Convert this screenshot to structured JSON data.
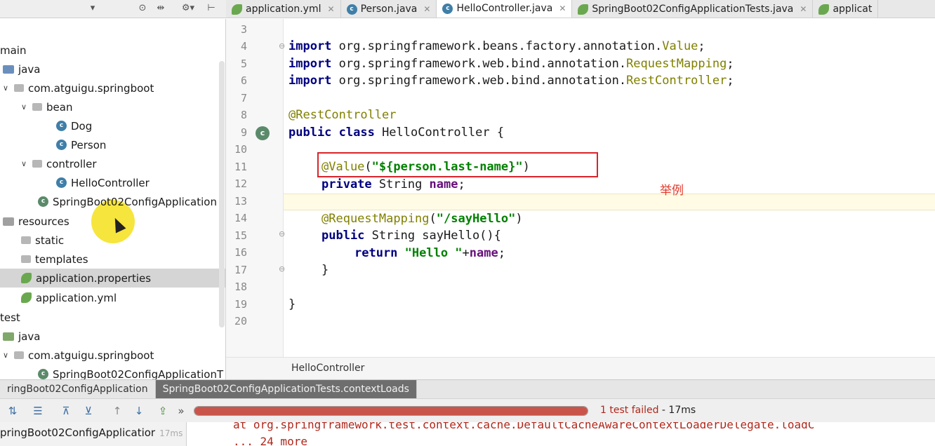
{
  "project_toolbar": {
    "dropdown_icon": "chevron-down-icon",
    "icons": [
      "target-icon",
      "split-icon",
      "gear-icon",
      "collapse-icon"
    ]
  },
  "editor_tabs": [
    {
      "label": "application.yml",
      "icon": "spring-leaf-icon",
      "active": false
    },
    {
      "label": "Person.java",
      "icon": "class-icon",
      "active": false
    },
    {
      "label": "HelloController.java",
      "icon": "class-icon",
      "active": true
    },
    {
      "label": "SpringBoot02ConfigApplicationTests.java",
      "icon": "spring-leaf-icon",
      "active": false
    },
    {
      "label": "applicat",
      "icon": "spring-leaf-icon",
      "active": false
    }
  ],
  "tree": {
    "main": "main",
    "java": "java",
    "pkg": "com.atguigu.springboot",
    "bean": "bean",
    "dog": "Dog",
    "person": "Person",
    "controller": "controller",
    "hello": "HelloController",
    "app": "SpringBoot02ConfigApplication",
    "resources": "resources",
    "static": "static",
    "templates": "templates",
    "app_props": "application.properties",
    "app_yml": "application.yml",
    "test": "test",
    "test_java": "java",
    "test_pkg": "com.atguigu.springboot",
    "test_class": "SpringBoot02ConfigApplicationT"
  },
  "code": {
    "lines": [
      "3",
      "4",
      "5",
      "6",
      "7",
      "8",
      "9",
      "10",
      "11",
      "12",
      "13",
      "14",
      "15",
      "16",
      "17",
      "18",
      "19",
      "20"
    ],
    "l4_kw": "import",
    "l4_pkg": " org.springframework.beans.factory.annotation.",
    "l4_cls": "Value",
    "l4_end": ";",
    "l5_kw": "import",
    "l5_pkg": " org.springframework.web.bind.annotation.",
    "l5_cls": "RequestMapping",
    "l5_end": ";",
    "l6_kw": "import",
    "l6_pkg": " org.springframework.web.bind.annotation.",
    "l6_cls": "RestController",
    "l6_end": ";",
    "l8": "@RestController",
    "l9_kw": "public class",
    "l9_rest": " HelloController {",
    "l11_ann": "@Value",
    "l11_p1": "(",
    "l11_str": "\"${person.last-name}\"",
    "l11_p2": ")",
    "l12_kw": "private",
    "l12_type": " String ",
    "l12_fld": "name",
    "l12_end": ";",
    "l14_ann": "@RequestMapping",
    "l14_p1": "(",
    "l14_str": "\"/sayHello\"",
    "l14_p2": ")",
    "l15_kw": "public",
    "l15_rest": " String sayHello(){",
    "l16_kw": "return",
    "l16_str": " \"Hello \"",
    "l16_plus": "+",
    "l16_fld": "name",
    "l16_end": ";",
    "l17": "}",
    "l19": "}"
  },
  "annotation_note": "举例",
  "breadcrumb": "HelloController",
  "run_tabs": [
    {
      "label": "ringBoot02ConfigApplication",
      "active": false
    },
    {
      "label": "SpringBoot02ConfigApplicationTests.contextLoads",
      "active": true
    }
  ],
  "run_toolbar_icons": [
    "sort-alpha-icon",
    "sort-duration-icon",
    "expand-all-icon",
    "collapse-all-icon",
    "up-arrow-icon",
    "down-arrow-icon",
    "export-icon",
    "more-icon"
  ],
  "test_result": {
    "progress": 1.0,
    "failed": "1 test failed",
    "time": " - 17ms"
  },
  "run_tree": {
    "item": "pringBoot02ConfigApplicatior",
    "time": "17ms"
  },
  "console": [
    "at org.springframework.test.context.cache.DefaultCacheAwareContextLoaderDelegate.loadC",
    "... 24 more"
  ],
  "colors": {
    "accent_red": "#d9242b",
    "note_red": "#e23a2b",
    "fail_red": "#c9554a",
    "keyword": "#000080",
    "string": "#008000",
    "annotation": "#808000",
    "field": "#660e7a"
  }
}
